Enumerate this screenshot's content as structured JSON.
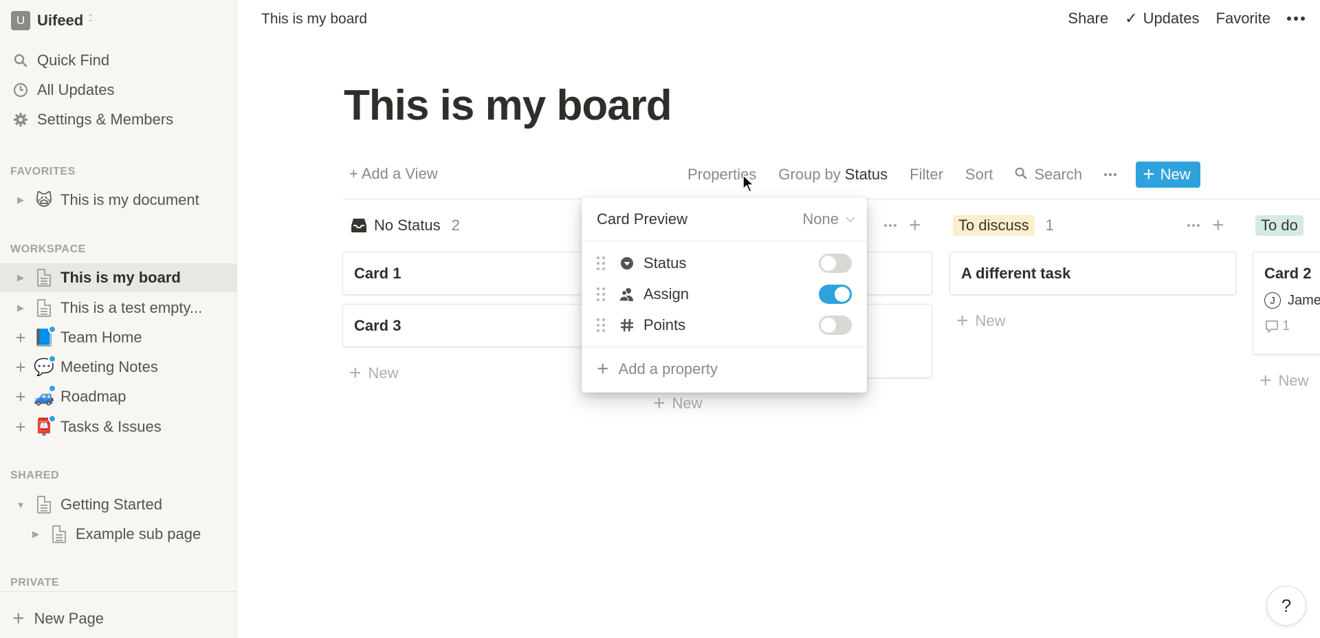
{
  "workspace": {
    "initial": "U",
    "name": "Uifeed"
  },
  "sidebar": {
    "nav": [
      {
        "label": "Quick Find",
        "icon": "search-icon"
      },
      {
        "label": "All Updates",
        "icon": "clock-icon"
      },
      {
        "label": "Settings & Members",
        "icon": "gear-icon"
      }
    ],
    "sections": {
      "favorites": "FAVORITES",
      "workspace": "WORKSPACE",
      "shared": "SHARED",
      "private": "PRIVATE"
    },
    "favorites": [
      {
        "label": "This is my document",
        "emoji": "🙀"
      }
    ],
    "workspace_items": [
      {
        "label": "This is my board",
        "icon": "page-icon",
        "active": true
      },
      {
        "label": "This is a test empty...",
        "icon": "page-icon"
      },
      {
        "label": "Team Home",
        "emoji": "📘"
      },
      {
        "label": "Meeting Notes",
        "emoji": "💬"
      },
      {
        "label": "Roadmap",
        "emoji": "🚙"
      },
      {
        "label": "Tasks & Issues",
        "emoji": "📮"
      }
    ],
    "shared_items": [
      {
        "label": "Getting Started",
        "icon": "page-icon",
        "expanded": true
      },
      {
        "label": "Example sub page",
        "icon": "page-icon"
      }
    ],
    "new_page": "New Page"
  },
  "topbar": {
    "breadcrumb": "This is my board",
    "share": "Share",
    "updates": "Updates",
    "favorite": "Favorite"
  },
  "page": {
    "title": "This is my board"
  },
  "toolbar": {
    "add_view": "+ Add a View",
    "properties": "Properties",
    "group_by": "Group by",
    "group_by_value": "Status",
    "filter": "Filter",
    "sort": "Sort",
    "search": "Search",
    "new": "New"
  },
  "board": {
    "columns": [
      {
        "name": "No Status",
        "count": "2",
        "cards": [
          {
            "title": "Card 1"
          },
          {
            "title": "Card 3"
          }
        ],
        "new_label": "New"
      },
      {
        "name": "",
        "count": "",
        "cards": [
          {
            "title": ""
          },
          {
            "title": ""
          }
        ],
        "new_label": "New"
      },
      {
        "name": "To discuss",
        "count": "1",
        "tag_color": "#fbeecc",
        "cards": [
          {
            "title": "A different task"
          }
        ],
        "new_label": "New"
      },
      {
        "name": "To do",
        "tag_color": "#d4ebe4",
        "cards": [
          {
            "title": "Card 2",
            "assignee": "James",
            "assignee_initial": "J",
            "comments": "1"
          }
        ],
        "new_label": "New"
      }
    ]
  },
  "properties_popup": {
    "card_preview_label": "Card Preview",
    "card_preview_value": "None",
    "properties": [
      {
        "name": "Status",
        "icon": "status-icon",
        "visible": false
      },
      {
        "name": "Assign",
        "icon": "person-icon",
        "visible": true
      },
      {
        "name": "Points",
        "icon": "hash-icon",
        "visible": false
      }
    ],
    "add_property": "Add a property"
  },
  "help": "?",
  "colors": {
    "accent": "#2ea2dc",
    "sidebar_bg": "#f7f6f3",
    "to_discuss_tag": "#fbeecc",
    "to_do_tag": "#d4ebe4"
  }
}
